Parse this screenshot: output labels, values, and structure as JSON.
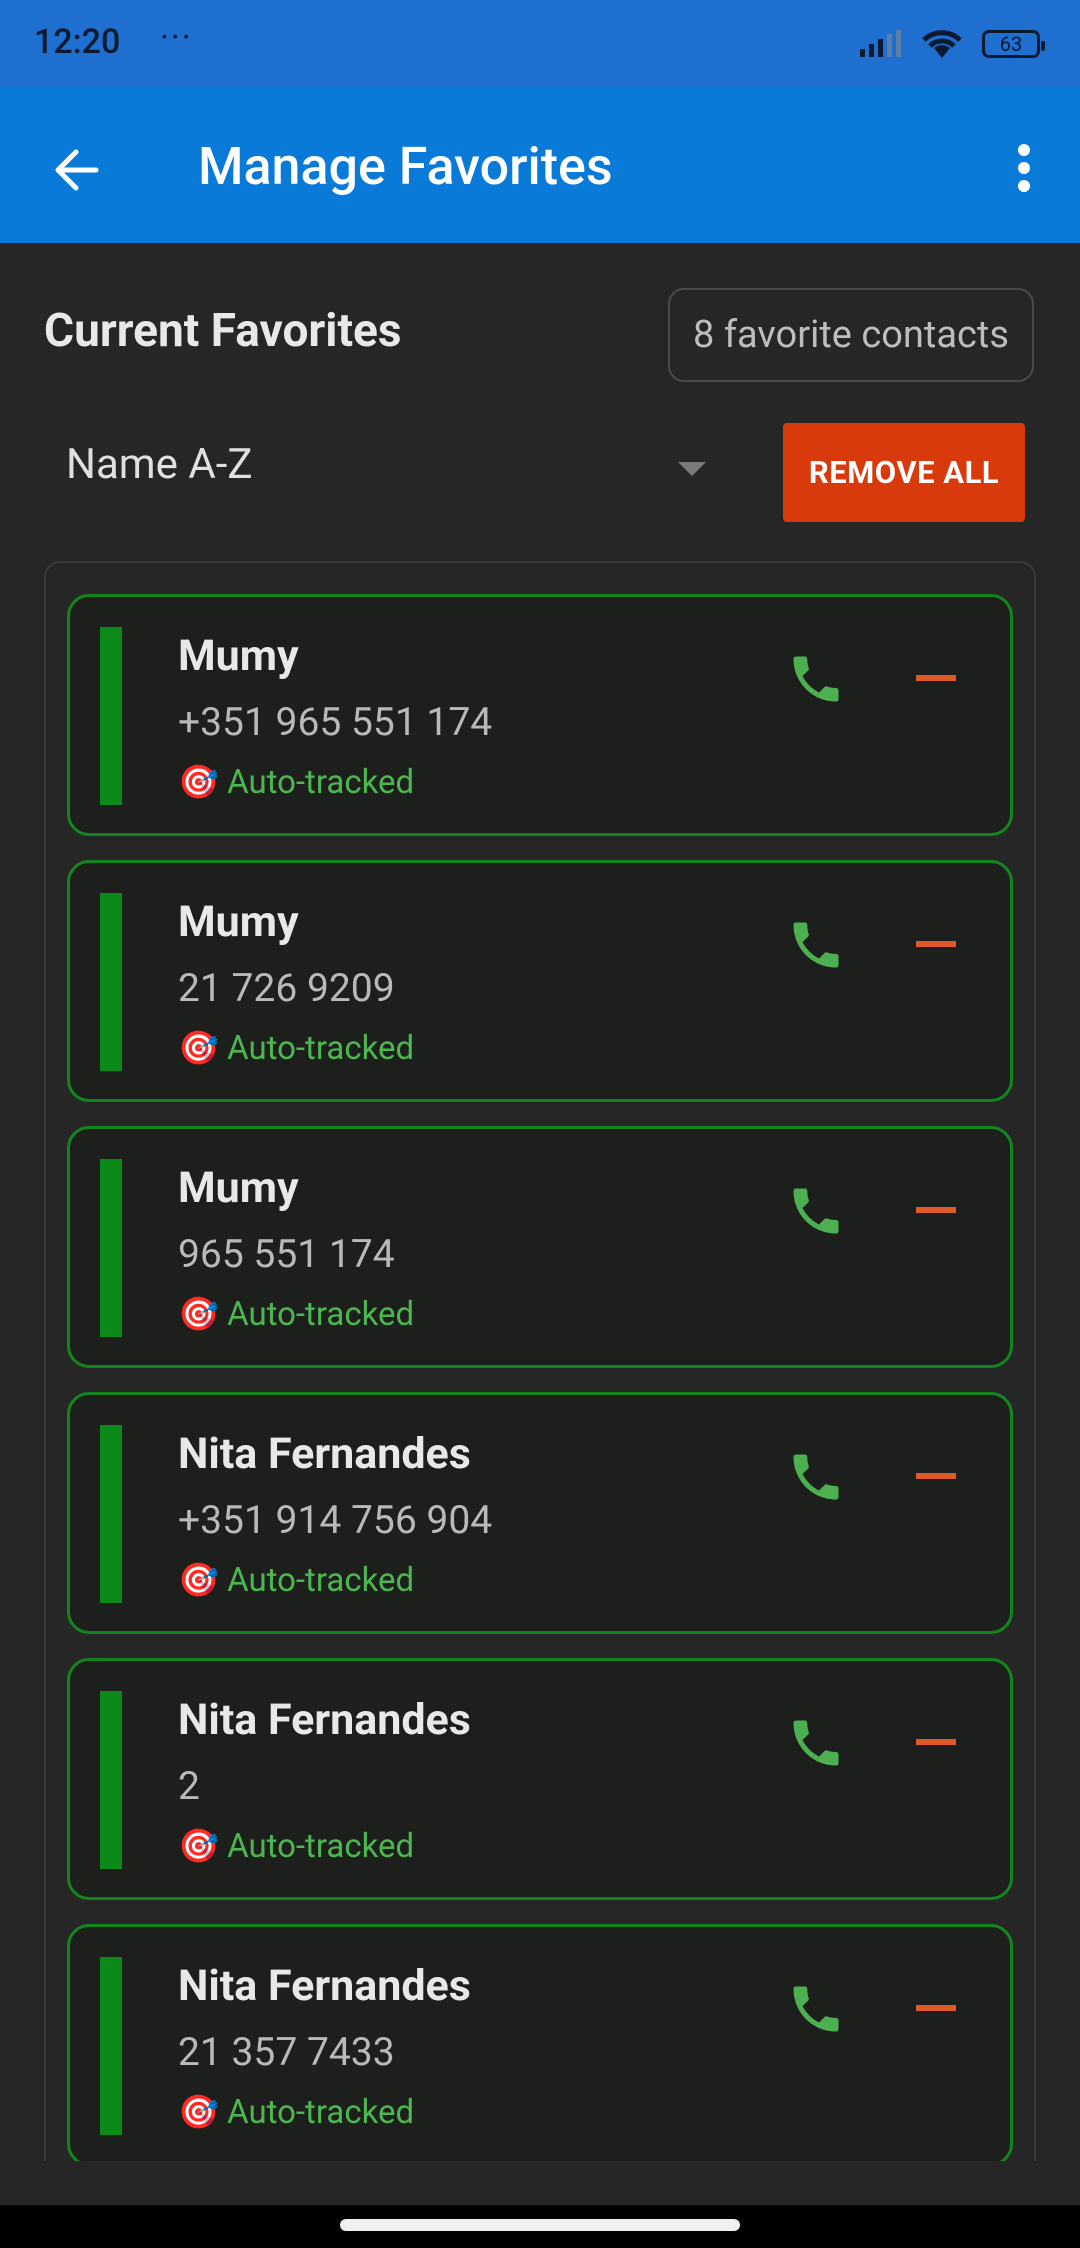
{
  "status": {
    "time": "12:20",
    "dots": "···",
    "battery": "63"
  },
  "appbar": {
    "title": "Manage Favorites"
  },
  "header": {
    "section_title": "Current Favorites",
    "count_text": "8 favorite contacts",
    "sort_value": "Name A-Z",
    "remove_all_label": "REMOVE ALL"
  },
  "favorites": [
    {
      "name": "Mumy",
      "phone": "+351 965 551 174",
      "tag": "Auto-tracked"
    },
    {
      "name": "Mumy",
      "phone": "21 726 9209",
      "tag": "Auto-tracked"
    },
    {
      "name": "Mumy",
      "phone": "965 551 174",
      "tag": "Auto-tracked"
    },
    {
      "name": "Nita Fernandes",
      "phone": "+351 914 756 904",
      "tag": "Auto-tracked"
    },
    {
      "name": "Nita Fernandes",
      "phone": "2",
      "tag": "Auto-tracked"
    },
    {
      "name": "Nita Fernandes",
      "phone": "21 357 7433",
      "tag": "Auto-tracked"
    }
  ],
  "icons": {
    "tag_icon": "target-emoji",
    "call": "phone-icon",
    "remove": "minus-icon"
  },
  "colors": {
    "appbar": "#0a7ad8",
    "statusbar": "#1f6fd1",
    "accent_green": "#13851e",
    "remove_red": "#d83a0b"
  }
}
